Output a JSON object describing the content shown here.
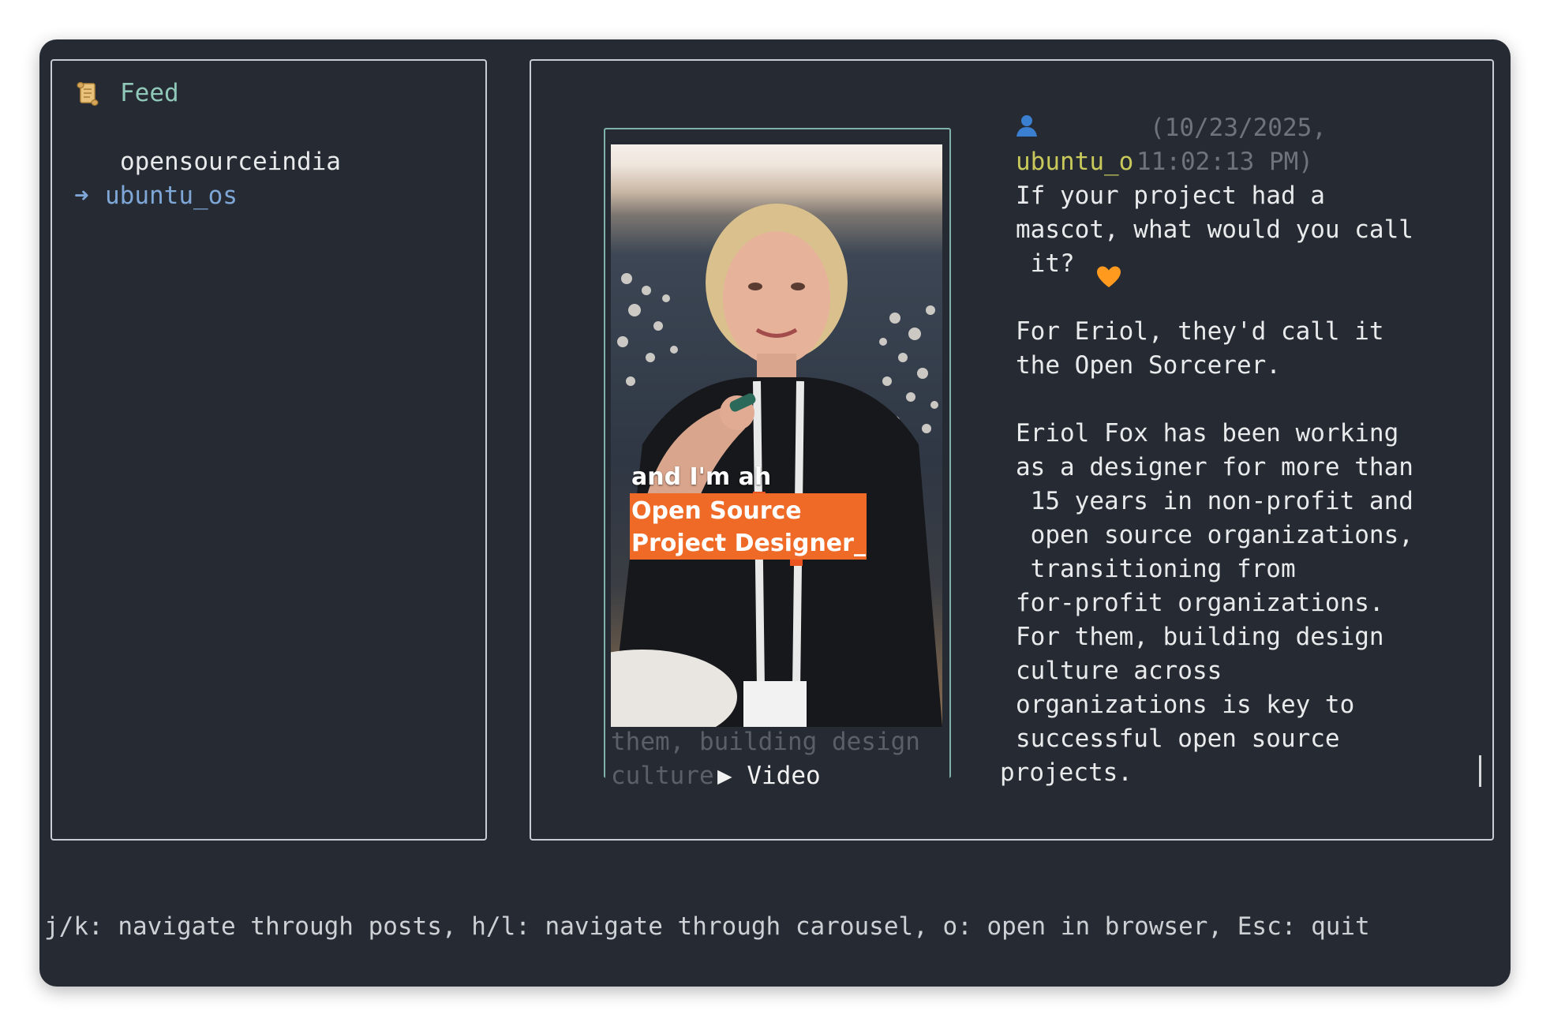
{
  "sidebar": {
    "title": "Feed",
    "title_icon": "scroll-icon",
    "items": [
      {
        "label": "opensourceindia",
        "selected": false
      },
      {
        "label": "ubuntu_os",
        "selected": true
      }
    ],
    "selected_marker": "➜"
  },
  "post": {
    "user_icon": "user-icon",
    "username": "ubuntu_o",
    "timestamp_line1": "(10/23/2025,",
    "timestamp_line2": "11:02:13 PM)",
    "lines": [
      "If your project had a",
      "mascot, what would you call",
      " it?",
      "",
      "For Eriol, they'd call it",
      "the Open Sorcerer.",
      "",
      "Eriol Fox has been working",
      "as a designer for more than",
      " 15 years in non-profit and",
      " open source organizations,",
      " transitioning from",
      "for-profit organizations.",
      "For them, building design",
      "culture across",
      "organizations is key to",
      "successful open source"
    ],
    "last_line": "projects.",
    "emoji": "orange-heart-icon"
  },
  "media": {
    "caption_line1": "and I'm ah",
    "caption_highlight_1": "Open Source",
    "caption_highlight_2": "Project Designer_",
    "ghost_line1": "them, building design",
    "ghost_line2": "culture",
    "type_label": "▶ Video"
  },
  "status_bar": {
    "text": "j/k: navigate through posts, h/l: navigate through carousel, o: open in browser, Esc: quit"
  },
  "colors": {
    "background": "#262b33",
    "feed_title": "#8fc7b8",
    "selected_item": "#7ea6d6",
    "username": "#c8c95a",
    "caption_highlight": "#ee6a26"
  }
}
